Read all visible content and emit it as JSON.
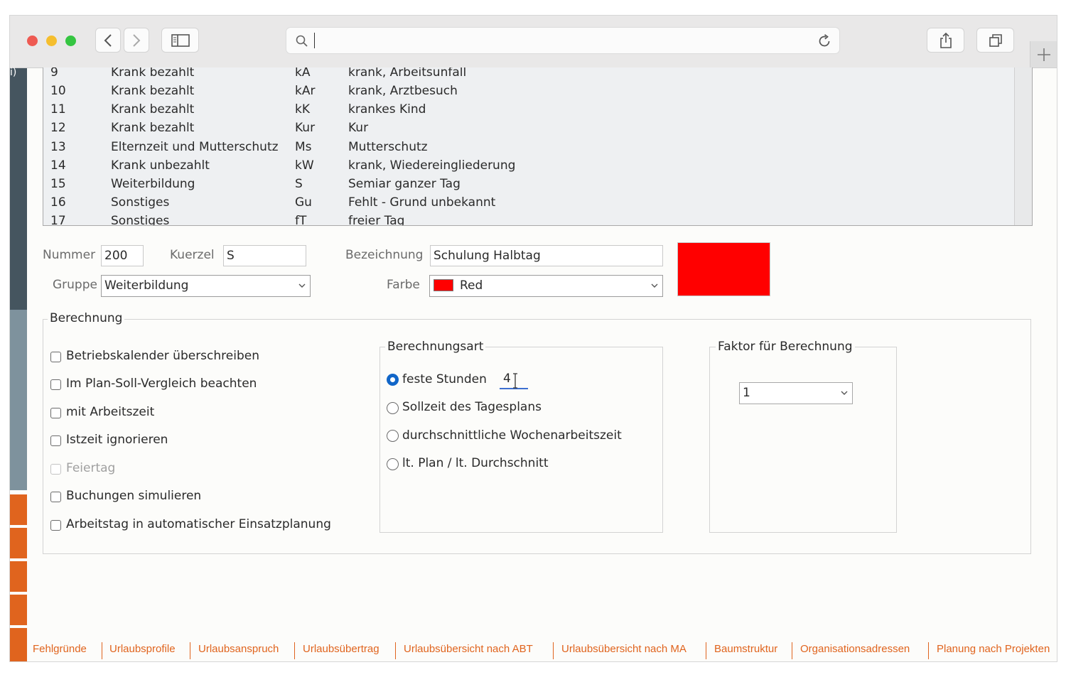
{
  "browser": {
    "address_value": "",
    "traffic_lights": {
      "close": "#ee5a52",
      "minimize": "#f5be2e",
      "zoom": "#35c541"
    },
    "icons": [
      "back-icon",
      "forward-icon",
      "sidebar-icon",
      "search-icon",
      "reload-icon",
      "share-icon",
      "tabs-icon",
      "plus-icon"
    ]
  },
  "left_strip": {
    "partial_label": "i)"
  },
  "table": {
    "rows": [
      {
        "nr": "9",
        "gruppe": "Krank bezahlt",
        "kuerzel": "kA",
        "bezeichnung": "krank, Arbeitsunfall"
      },
      {
        "nr": "10",
        "gruppe": "Krank bezahlt",
        "kuerzel": "kAr",
        "bezeichnung": "krank, Arztbesuch"
      },
      {
        "nr": "11",
        "gruppe": "Krank bezahlt",
        "kuerzel": "kK",
        "bezeichnung": "krankes Kind"
      },
      {
        "nr": "12",
        "gruppe": "Krank bezahlt",
        "kuerzel": "Kur",
        "bezeichnung": "Kur"
      },
      {
        "nr": "13",
        "gruppe": "Elternzeit und Mutterschutz",
        "kuerzel": "Ms",
        "bezeichnung": "Mutterschutz"
      },
      {
        "nr": "14",
        "gruppe": "Krank unbezahlt",
        "kuerzel": "kW",
        "bezeichnung": "krank, Wiedereingliederung"
      },
      {
        "nr": "15",
        "gruppe": "Weiterbildung",
        "kuerzel": "S",
        "bezeichnung": "Semiar ganzer Tag"
      },
      {
        "nr": "16",
        "gruppe": "Sonstiges",
        "kuerzel": "Gu",
        "bezeichnung": "Fehlt - Grund unbekannt"
      },
      {
        "nr": "17",
        "gruppe": "Sonstiges",
        "kuerzel": "fT",
        "bezeichnung": "freier Tag"
      }
    ]
  },
  "form": {
    "nummer_label": "Nummer",
    "nummer_value": "200",
    "kuerzel_label": "Kuerzel",
    "kuerzel_value": "S",
    "bezeichnung_label": "Bezeichnung",
    "bezeichnung_value": "Schulung Halbtag",
    "gruppe_label": "Gruppe",
    "gruppe_value": "Weiterbildung",
    "farbe_label": "Farbe",
    "farbe_value": "Red",
    "farbe_color": "#ff0000"
  },
  "berechnung": {
    "title": "Berechnung",
    "checkboxes": [
      {
        "label": "Betriebskalender überschreiben",
        "checked": false,
        "disabled": false
      },
      {
        "label": "Im Plan-Soll-Vergleich beachten",
        "checked": false,
        "disabled": false
      },
      {
        "label": "mit Arbeitszeit",
        "checked": false,
        "disabled": false
      },
      {
        "label": "Istzeit ignorieren",
        "checked": false,
        "disabled": false
      },
      {
        "label": "Feiertag",
        "checked": false,
        "disabled": true
      },
      {
        "label": "Buchungen simulieren",
        "checked": false,
        "disabled": false
      },
      {
        "label": "Arbeitstag in automatischer Einsatzplanung",
        "checked": false,
        "disabled": false
      }
    ],
    "art": {
      "title": "Berechnungsart",
      "options": [
        {
          "label": "feste Stunden",
          "selected": true
        },
        {
          "label": "Sollzeit des Tagesplans",
          "selected": false
        },
        {
          "label": "durchschnittliche Wochenarbeitszeit",
          "selected": false
        },
        {
          "label": "lt. Plan / lt. Durchschnitt",
          "selected": false
        }
      ],
      "stunden_value": "4"
    },
    "faktor": {
      "title": "Faktor für Berechnung",
      "value": "1"
    }
  },
  "bottom_nav": {
    "links": [
      "Fehlgründe",
      "Urlaubsprofile",
      "Urlaubsanspruch",
      "Urlaubsübertrag",
      "Urlaubsübersicht nach ABT",
      "Urlaubsübersicht nach MA",
      "Baumstruktur",
      "Organisationsadressen",
      "Planung nach Projekten"
    ],
    "color": "#e0641e"
  }
}
